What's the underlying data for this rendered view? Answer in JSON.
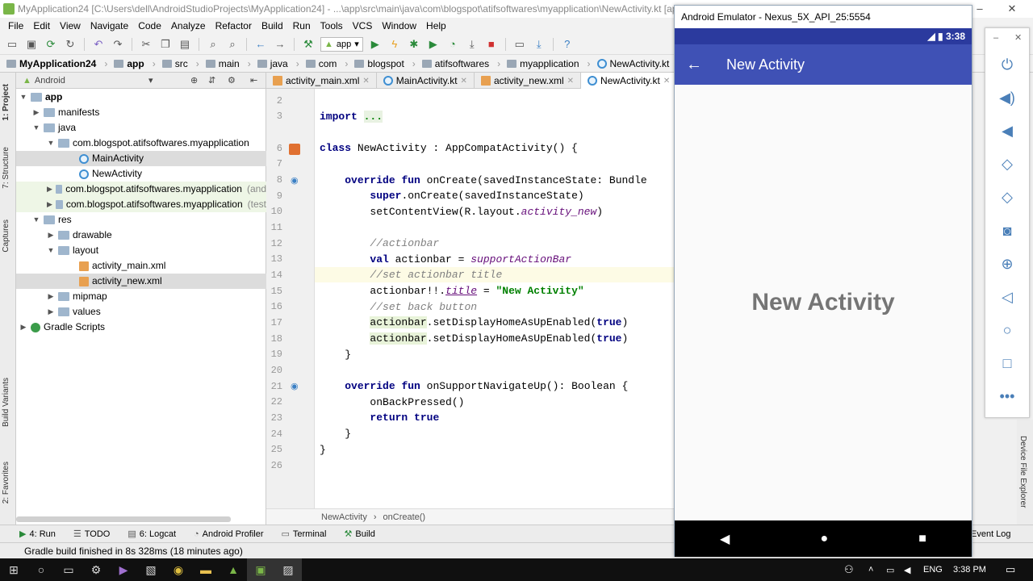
{
  "window": {
    "title": "MyApplication24 [C:\\Users\\dell\\AndroidStudioProjects\\MyApplication24] - ...\\app\\src\\main\\java\\com\\blogspot\\atifsoftwares\\myapplication\\NewActivity.kt [app] - Android Studio"
  },
  "menu": [
    "File",
    "Edit",
    "View",
    "Navigate",
    "Code",
    "Analyze",
    "Refactor",
    "Build",
    "Run",
    "Tools",
    "VCS",
    "Window",
    "Help"
  ],
  "toolbar": {
    "config": "app"
  },
  "breadcrumbs": [
    "MyApplication24",
    "app",
    "src",
    "main",
    "java",
    "com",
    "blogspot",
    "atifsoftwares",
    "myapplication",
    "NewActivity.kt"
  ],
  "left_tools": {
    "project": "1: Project",
    "structure": "7: Structure",
    "captures": "Captures",
    "build_variants": "Build Variants",
    "favorites": "2: Favorites"
  },
  "project": {
    "view": "Android",
    "tree": [
      {
        "label": "app",
        "bold": true
      },
      {
        "label": "manifests"
      },
      {
        "label": "java"
      },
      {
        "label": "com.blogspot.atifsoftwares.myapplication"
      },
      {
        "label": "MainActivity"
      },
      {
        "label": "NewActivity"
      },
      {
        "label": "com.blogspot.atifsoftwares.myapplication",
        "suffix": "(and"
      },
      {
        "label": "com.blogspot.atifsoftwares.myapplication",
        "suffix": "(test"
      },
      {
        "label": "res"
      },
      {
        "label": "drawable"
      },
      {
        "label": "layout"
      },
      {
        "label": "activity_main.xml"
      },
      {
        "label": "activity_new.xml"
      },
      {
        "label": "mipmap"
      },
      {
        "label": "values"
      },
      {
        "label": "Gradle Scripts"
      }
    ]
  },
  "tabs": [
    "activity_main.xml",
    "MainActivity.kt",
    "activity_new.xml",
    "NewActivity.kt"
  ],
  "code": {
    "line_numbers": [
      "2",
      "3",
      "6",
      "7",
      "8",
      "9",
      "10",
      "11",
      "12",
      "13",
      "14",
      "15",
      "16",
      "17",
      "18",
      "19",
      "20",
      "21",
      "22",
      "23",
      "24",
      "25",
      "26"
    ],
    "import_kw": "import",
    "import_dots": "...",
    "l6_kw": "class",
    "l6_rest": " NewActivity : AppCompatActivity() {",
    "l8_kw1": "override",
    "l8_kw2": " fun",
    "l8_rest": " onCreate(savedInstanceState: Bundle",
    "l9_kw": "super",
    "l9_rest": ".onCreate(savedInstanceState)",
    "l10_pre": "setContentView(R.layout.",
    "l10_it": "activity_new",
    "l10_post": ")",
    "l12": "//actionbar",
    "l13_kw": "val",
    "l13_mid": " actionbar = ",
    "l13_it": "supportActionBar",
    "l14": "//set actionbar title",
    "l15_pre": "actionbar!!.",
    "l15_prop": "title",
    "l15_eq": " = ",
    "l15_str": "\"New Activity\"",
    "l16": "//set back button",
    "l17_a": "actionbar",
    "l17_b": ".setDisplayHomeAsUpEnabled(",
    "l17_kw": "true",
    "l17_c": ")",
    "l18_a": "actionbar",
    "l18_b": ".setDisplayHomeAsUpEnabled(",
    "l18_kw": "true",
    "l18_c": ")",
    "l19": "}",
    "l21_kw1": "override",
    "l21_kw2": " fun",
    "l21_rest": " onSupportNavigateUp(): Boolean {",
    "l22": "onBackPressed()",
    "l23_kw": "return",
    "l23_kw2": " true",
    "l24": "}",
    "l25": "}"
  },
  "editor_breadcrumb": [
    "NewActivity",
    "onCreate()"
  ],
  "bottom_tools": [
    "4: Run",
    "TODO",
    "6: Logcat",
    "Android Profiler",
    "Terminal",
    "Build"
  ],
  "event_log": "Event Log",
  "device_explorer": "Device File Explorer",
  "status": "Gradle build finished in 8s 328ms (18 minutes ago)",
  "emulator": {
    "title": "Android Emulator - Nexus_5X_API_25:5554",
    "time": "3:38",
    "app_title": "New Activity",
    "content_text": "New Activity"
  },
  "taskbar": {
    "lang": "ENG",
    "time": "3:38 PM"
  }
}
